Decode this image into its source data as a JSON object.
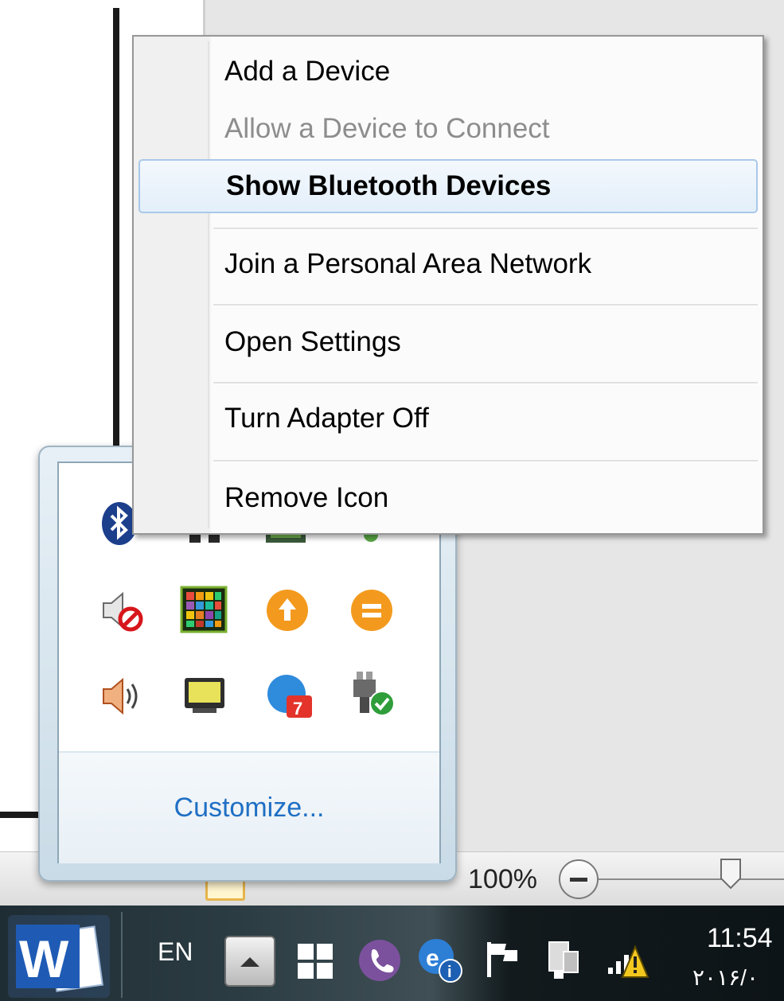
{
  "context_menu": {
    "items": [
      {
        "label": "Add a Device",
        "state": "normal"
      },
      {
        "label": "Allow a Device to Connect",
        "state": "disabled"
      },
      {
        "label": "Show Bluetooth Devices",
        "state": "highlighted"
      },
      {
        "label": "Join a Personal Area Network",
        "state": "normal"
      },
      {
        "label": "Open Settings",
        "state": "normal"
      },
      {
        "label": "Turn Adapter Off",
        "state": "normal"
      },
      {
        "label": "Remove Icon",
        "state": "normal"
      }
    ]
  },
  "tray_overflow": {
    "customize_label": "Customize...",
    "icons": [
      "bluetooth-icon",
      "network-adapter-icon",
      "graphics-card-icon",
      "green-arrow-icon",
      "volume-muted-icon",
      "color-grid-icon",
      "orange-upload-icon",
      "orange-equals-icon",
      "volume-icon",
      "monitor-icon",
      "notification-badge-icon",
      "power-plug-check-icon"
    ],
    "badge_count": "7"
  },
  "status_bar": {
    "zoom_level": "100%"
  },
  "taskbar": {
    "language": "EN",
    "time": "11:54",
    "date": "٢٠١۶/٠"
  },
  "colors": {
    "menu_highlight": "#e3effa",
    "link_blue": "#1f6fc4",
    "taskbar": "#1e2d33"
  }
}
